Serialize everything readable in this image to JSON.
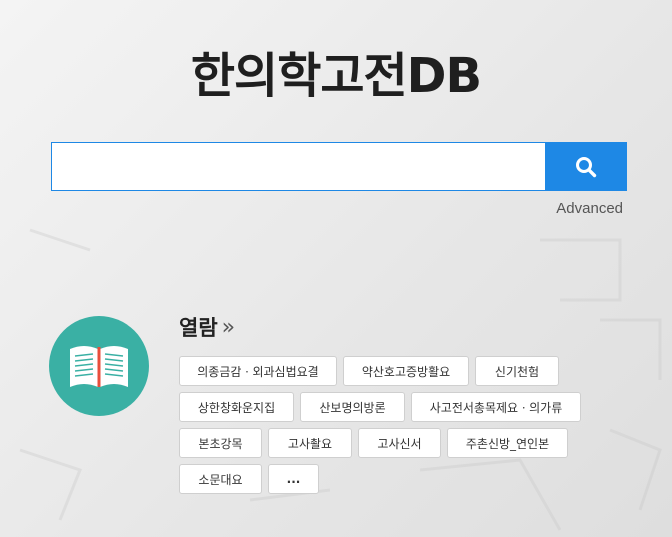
{
  "site": {
    "title": "한의학고전DB"
  },
  "search": {
    "placeholder": "",
    "value": "",
    "button_icon": "search-icon",
    "advanced_label": "Advanced"
  },
  "browse": {
    "icon": "open-book-icon",
    "heading": "열람",
    "arrow": "»",
    "tags": [
      [
        "의종금감ㆍ외과심법요결",
        "약산호고증방활요",
        "신기천험"
      ],
      [
        "상한창화운지집",
        "산보명의방론",
        "사고전서총목제요ㆍ의가류"
      ],
      [
        "본초강목",
        "고사촬요",
        "고사신서",
        "주촌신방_연인본"
      ],
      [
        "소문대요",
        "..."
      ]
    ]
  },
  "colors": {
    "accent": "#1e88e5",
    "book_circle": "#3ab0a4",
    "title": "#1f1f1f"
  }
}
